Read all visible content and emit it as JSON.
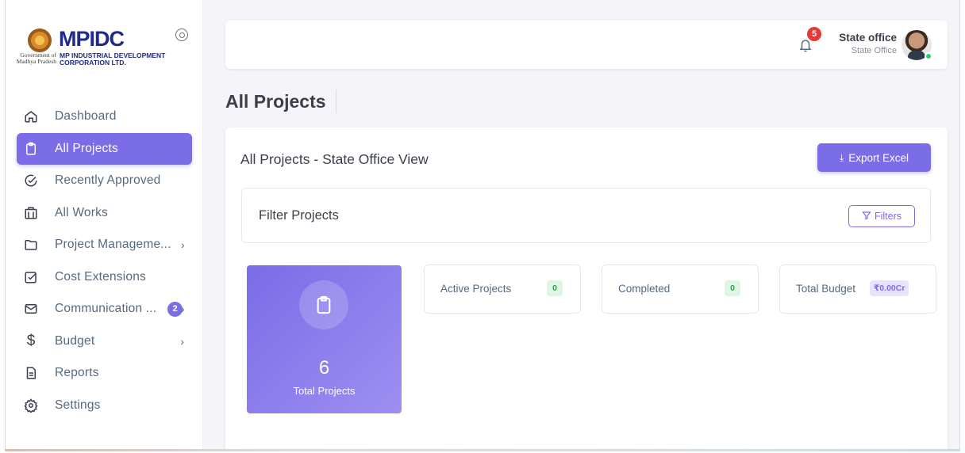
{
  "brand": {
    "logo_text": "MPIDC",
    "gov_text": "Government of Madhya Pradesh",
    "corp_line1": "MP INDUSTRIAL DEVELOPMENT",
    "corp_line2": "CORPORATION LTD."
  },
  "sidebar": {
    "items": [
      {
        "label": "Dashboard",
        "icon": "home-icon"
      },
      {
        "label": "All Projects",
        "icon": "clipboard-icon",
        "active": true
      },
      {
        "label": "Recently Approved",
        "icon": "check-circle-icon"
      },
      {
        "label": "All Works",
        "icon": "building-icon"
      },
      {
        "label": "Project Manageme...",
        "icon": "folder-icon",
        "has_arrow": true
      },
      {
        "label": "Cost Extensions",
        "icon": "edit-square-icon"
      },
      {
        "label": "Communication ...",
        "icon": "mail-icon",
        "badge": "2",
        "has_arrow": true
      },
      {
        "label": "Budget",
        "icon": "dollar-icon",
        "has_arrow": true
      },
      {
        "label": "Reports",
        "icon": "report-icon"
      },
      {
        "label": "Settings",
        "icon": "gear-icon"
      }
    ]
  },
  "topbar": {
    "notification_count": "5",
    "user_name": "State office",
    "user_role": "State Office"
  },
  "page": {
    "title": "All Projects",
    "card_title": "All Projects - State Office View",
    "export_label": "Export Excel",
    "filter_title": "Filter Projects",
    "filters_label": "Filters"
  },
  "stats": {
    "total": {
      "value": "6",
      "label": "Total Projects"
    },
    "active": {
      "label": "Active Projects",
      "value": "0"
    },
    "completed": {
      "label": "Completed",
      "value": "0"
    },
    "budget": {
      "label": "Total Budget",
      "value": "₹0.00Cr"
    }
  },
  "colors": {
    "accent": "#7b6ce8",
    "success": "#28a745",
    "danger": "#e53935"
  }
}
